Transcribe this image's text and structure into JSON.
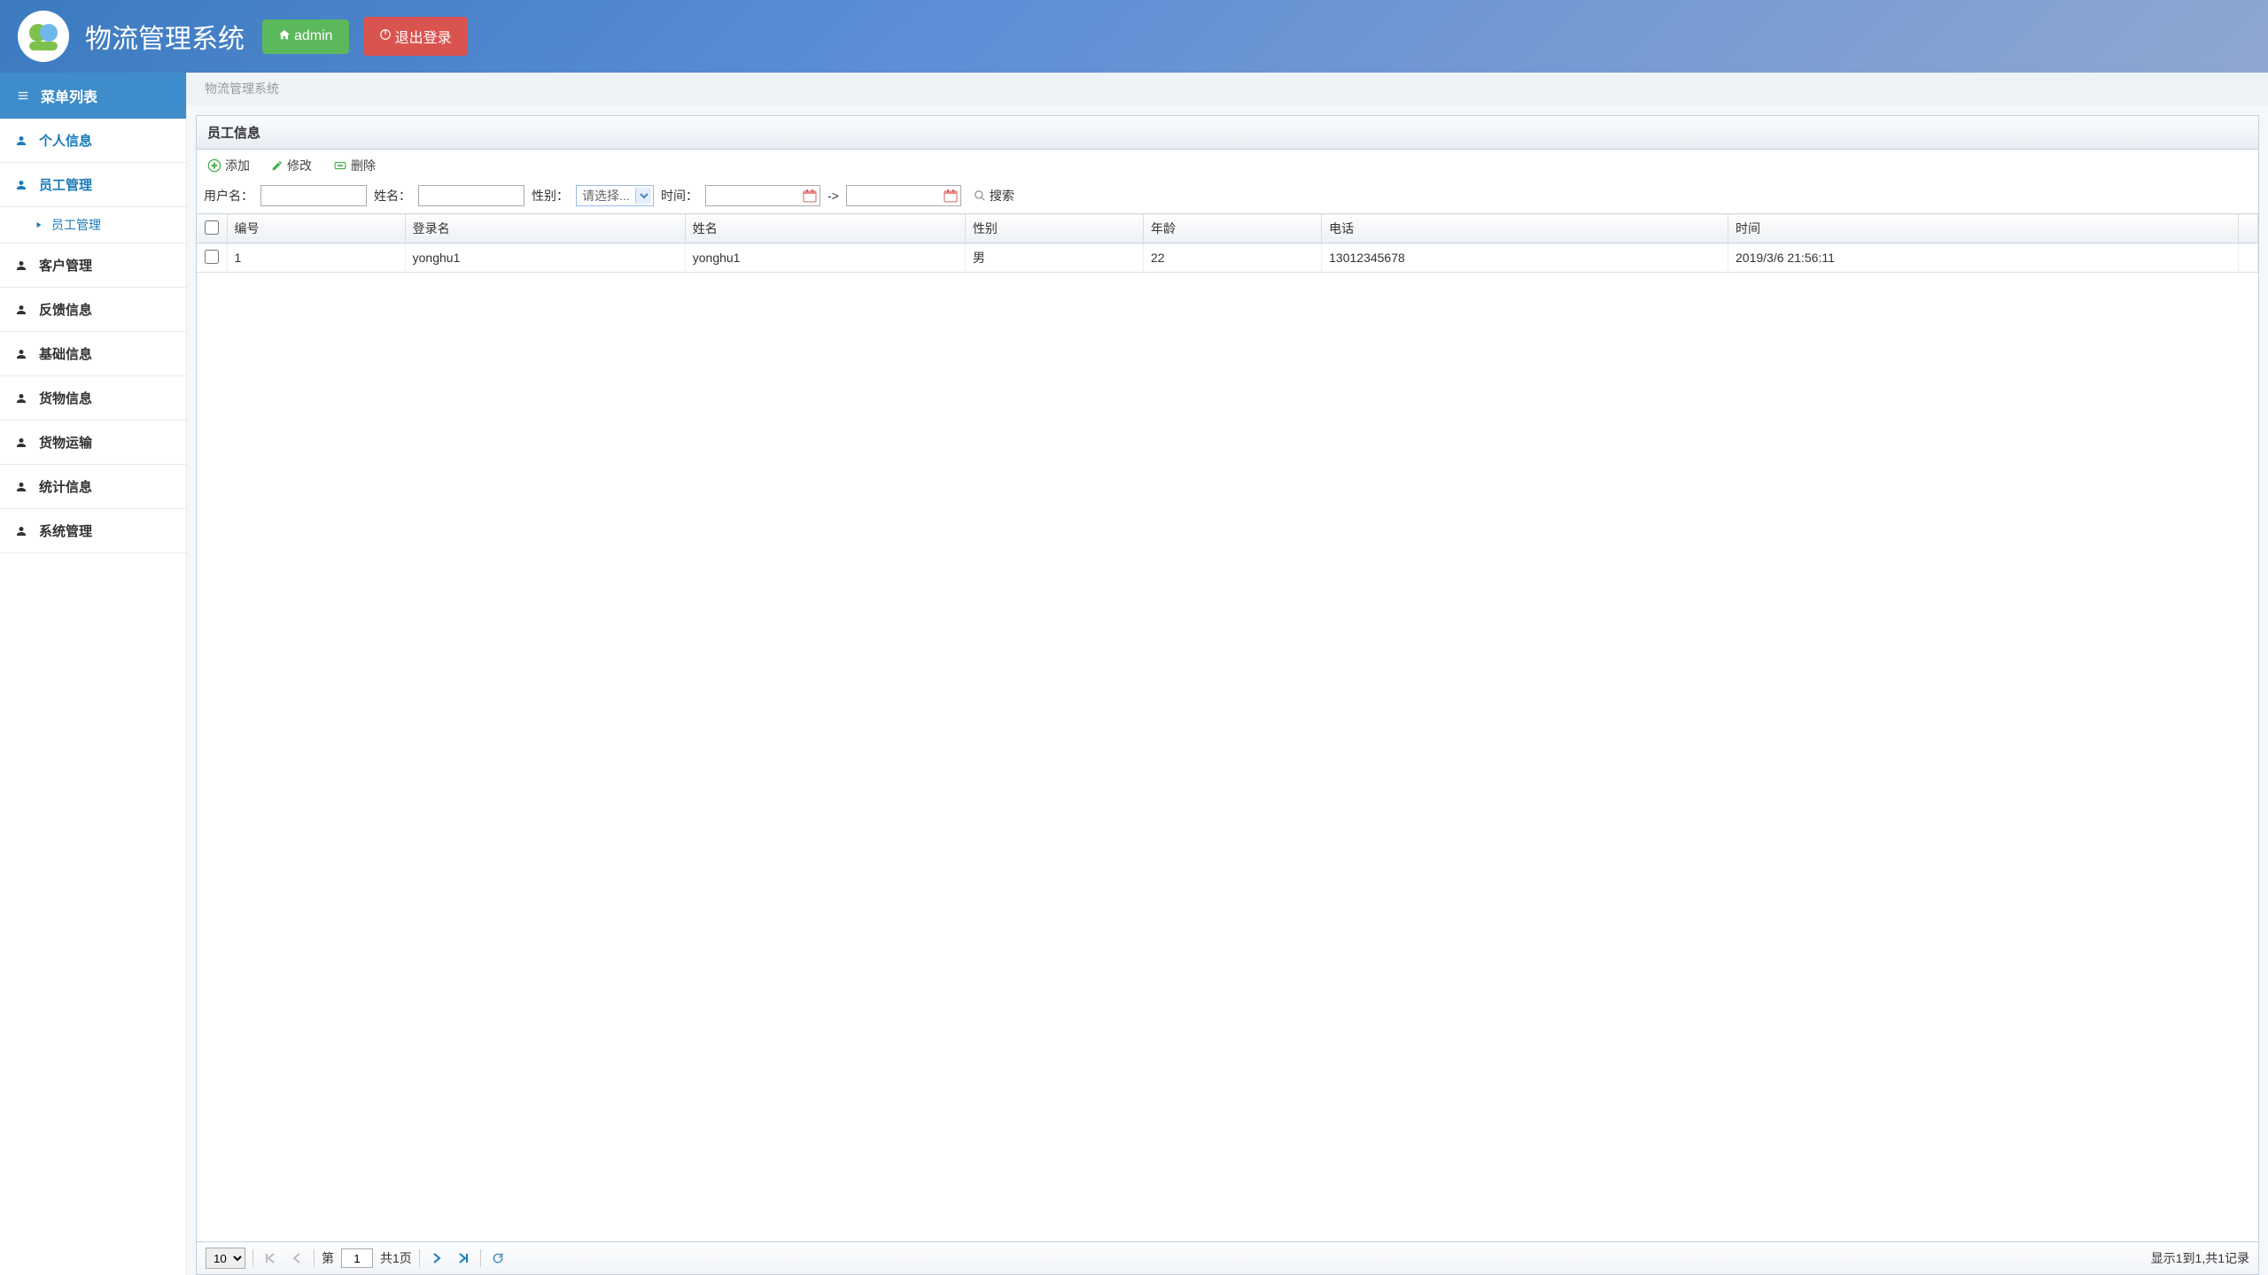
{
  "header": {
    "title": "物流管理系统",
    "admin_label": "admin",
    "logout_label": "退出登录"
  },
  "sidebar": {
    "menu_title": "菜单列表",
    "items": [
      {
        "label": "个人信息",
        "active": true
      },
      {
        "label": "员工管理",
        "active": true,
        "subitems": [
          {
            "label": "员工管理"
          }
        ]
      },
      {
        "label": "客户管理"
      },
      {
        "label": "反馈信息"
      },
      {
        "label": "基础信息"
      },
      {
        "label": "货物信息"
      },
      {
        "label": "货物运输"
      },
      {
        "label": "统计信息"
      },
      {
        "label": "系统管理"
      }
    ]
  },
  "breadcrumb": "物流管理系统",
  "panel": {
    "title": "员工信息",
    "toolbar": {
      "add": "添加",
      "edit": "修改",
      "delete": "删除"
    },
    "filters": {
      "username_label": "用户名：",
      "name_label": "姓名：",
      "gender_label": "性别：",
      "gender_placeholder": "请选择...",
      "time_label": "时间：",
      "range_sep": "->",
      "search_label": "搜索"
    },
    "columns": [
      "编号",
      "登录名",
      "姓名",
      "性别",
      "年龄",
      "电话",
      "时间"
    ],
    "rows": [
      {
        "id": "1",
        "login": "yonghu1",
        "name": "yonghu1",
        "gender": "男",
        "age": "22",
        "phone": "13012345678",
        "time": "2019/3/6 21:56:11"
      }
    ]
  },
  "pager": {
    "page_size": "10",
    "page_prefix": "第",
    "page_value": "1",
    "total_pages_label": "共1页",
    "info": "显示1到1,共1记录"
  }
}
